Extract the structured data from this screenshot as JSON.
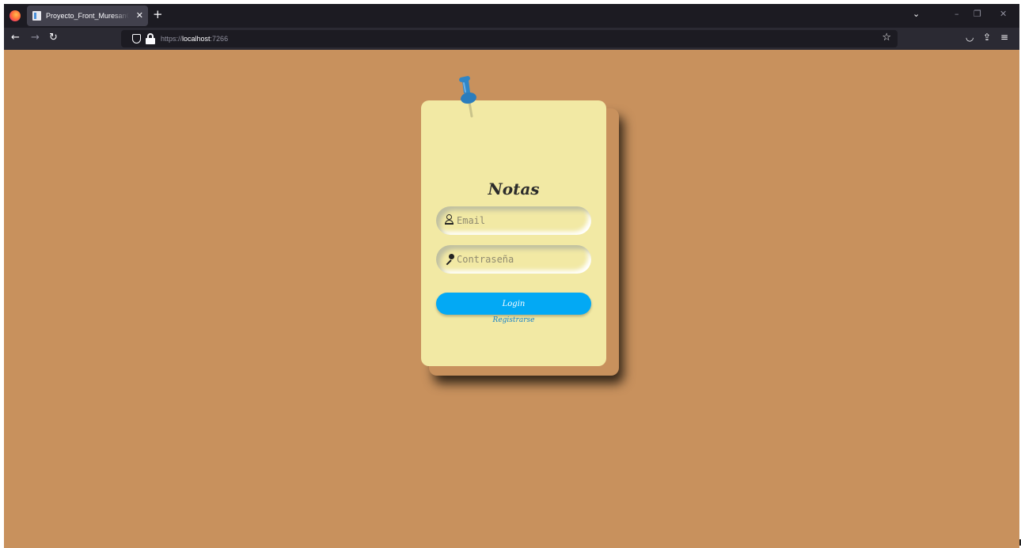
{
  "browser": {
    "tab": {
      "title": "Proyecto_Front_MuresanCristian",
      "close": "✕"
    },
    "new_tab": "+",
    "tab_list": "⌄",
    "window_controls": {
      "minimize": "–",
      "restore": "❐",
      "close": "✕"
    },
    "nav": {
      "back": "←",
      "forward": "→",
      "reload": "↻"
    },
    "url": {
      "scheme": "https://",
      "host": "localhost",
      "port": ":7266"
    },
    "bookmark": "☆",
    "toolbar": {
      "pocket": "◡",
      "extensions": "⇪",
      "menu": "≡"
    }
  },
  "note": {
    "title": "Notas",
    "email": {
      "placeholder": "Email",
      "icon": "user-icon"
    },
    "password": {
      "placeholder": "Contraseña",
      "icon": "key-icon"
    },
    "login_label": "Login",
    "register_label": "Registrarse"
  },
  "colors": {
    "background": "#c8915d",
    "note": "#f2e9a4",
    "button": "#03a9f4",
    "link": "#1580c8",
    "pin": "#2f86c7"
  }
}
